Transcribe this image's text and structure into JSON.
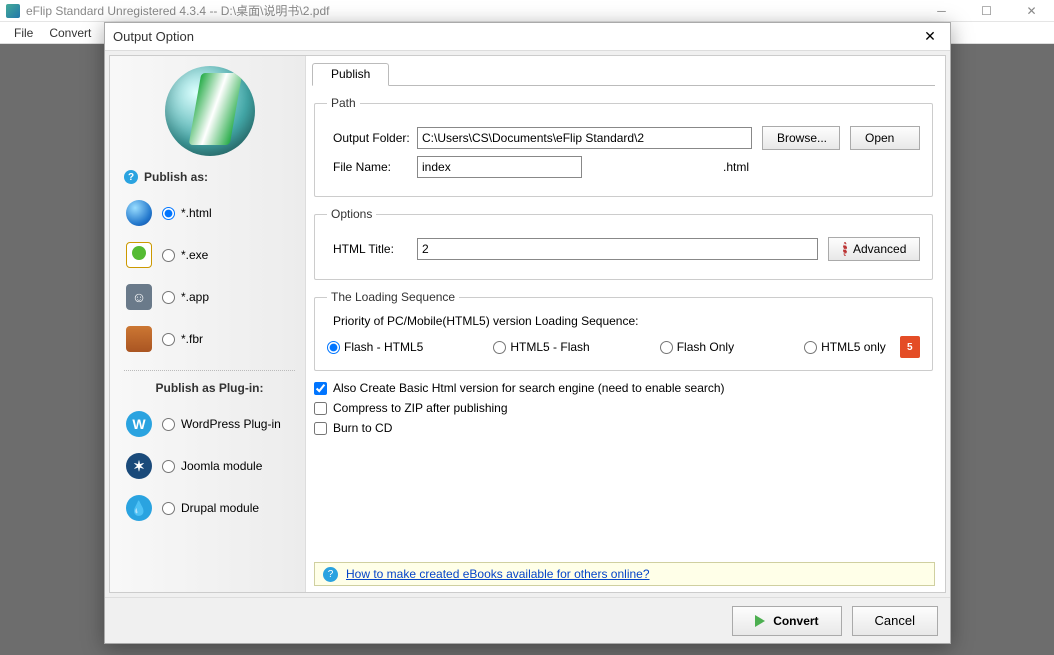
{
  "window": {
    "title": "eFlip Standard Unregistered 4.3.4  -- D:\\桌面\\说明书\\2.pdf"
  },
  "menu": {
    "file": "File",
    "convert": "Convert"
  },
  "dialog": {
    "title": "Output Option",
    "tab": "Publish",
    "path": {
      "legend": "Path",
      "output_folder_label": "Output Folder:",
      "output_folder_value": "C:\\Users\\CS\\Documents\\eFlip Standard\\2",
      "browse": "Browse...",
      "open": "Open",
      "file_name_label": "File Name:",
      "file_name_value": "index",
      "ext": ".html"
    },
    "options": {
      "legend": "Options",
      "html_title_label": "HTML Title:",
      "html_title_value": "2",
      "advanced": "Advanced"
    },
    "loading": {
      "legend": "The Loading Sequence",
      "heading": "Priority of PC/Mobile(HTML5) version Loading Sequence:",
      "opts": [
        "Flash - HTML5",
        "HTML5 - Flash",
        "Flash Only",
        "HTML5 only"
      ],
      "html5_badge": "5"
    },
    "checks": {
      "also_create": "Also Create Basic Html version for search engine (need to enable search)",
      "compress": "Compress to ZIP after publishing",
      "burn": "Burn to CD"
    },
    "help_link": "How to make created eBooks available for others online?",
    "footer": {
      "convert": "Convert",
      "cancel": "Cancel"
    }
  },
  "sidebar": {
    "publish_as": "Publish as:",
    "items": [
      {
        "label": "*.html"
      },
      {
        "label": "*.exe"
      },
      {
        "label": "*.app"
      },
      {
        "label": "*.fbr"
      }
    ],
    "plugin_head": "Publish as Plug-in:",
    "plugins": [
      {
        "label": "WordPress Plug-in"
      },
      {
        "label": "Joomla module"
      },
      {
        "label": "Drupal module"
      }
    ]
  }
}
